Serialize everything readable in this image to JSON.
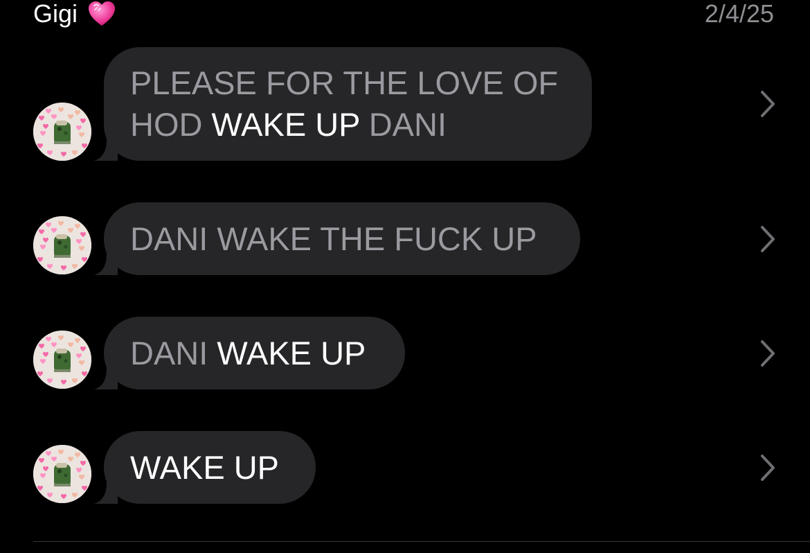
{
  "header": {
    "contact_name": "Gigi",
    "heart_icon": "pink-heart-emoji",
    "date": "2/4/25"
  },
  "messages": [
    {
      "lines": [
        [
          {
            "text": "PLEASE FOR THE LOVE OF",
            "style": "dim"
          }
        ],
        [
          {
            "text": "HOD ",
            "style": "dim"
          },
          {
            "text": "WAKE UP",
            "style": "bright"
          },
          {
            "text": " DANI",
            "style": "dim"
          }
        ]
      ]
    },
    {
      "lines": [
        [
          {
            "text": "DANI WAKE THE FUCK UP",
            "style": "dim"
          }
        ]
      ]
    },
    {
      "lines": [
        [
          {
            "text": "DANI ",
            "style": "dim"
          },
          {
            "text": "WAKE UP",
            "style": "bright"
          }
        ]
      ]
    },
    {
      "lines": [
        [
          {
            "text": "WAKE UP",
            "style": "bright"
          }
        ]
      ]
    }
  ],
  "colors": {
    "background": "#000000",
    "bubble": "#262628",
    "text_bright": "#ffffff",
    "text_dim": "#9a9aa0",
    "date": "#8e8e93",
    "chevron": "#6e6e73"
  }
}
